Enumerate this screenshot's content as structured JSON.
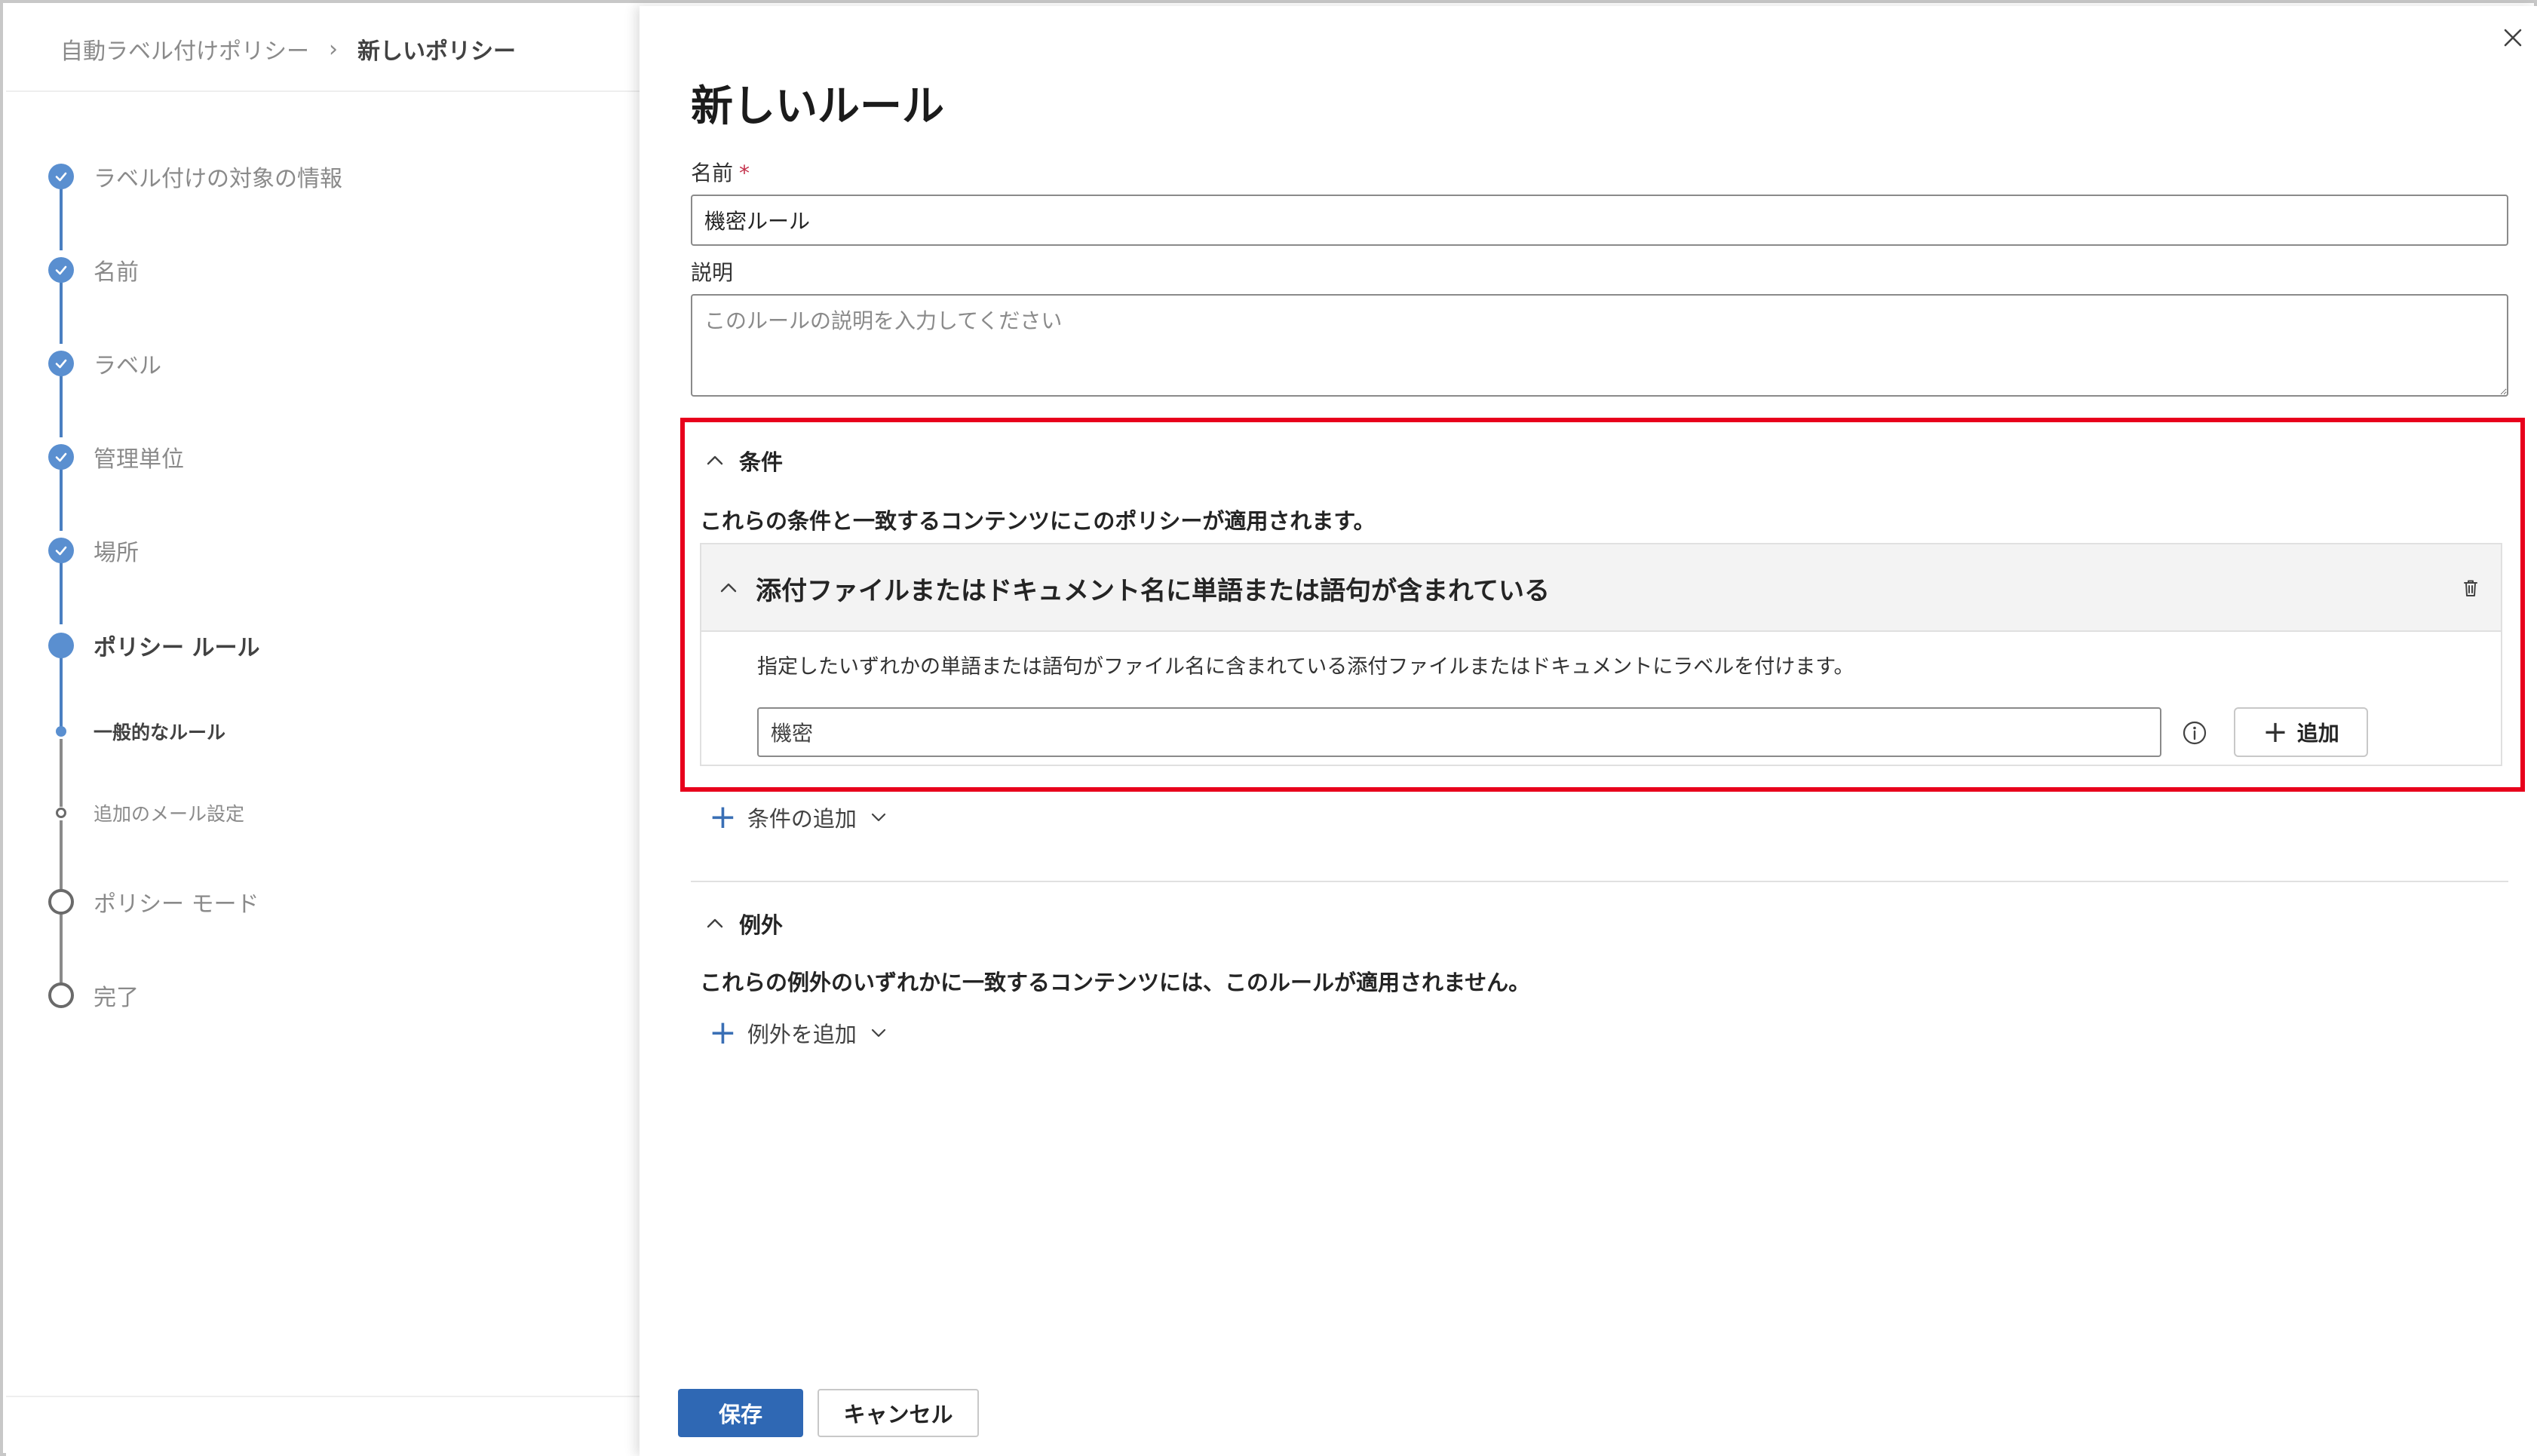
{
  "breadcrumb": {
    "parent": "自動ラベル付けポリシー",
    "separator": "›",
    "current": "新しいポリシー"
  },
  "wizard": {
    "steps": [
      {
        "label": "ラベル付けの対象の情報",
        "status": "completed"
      },
      {
        "label": "名前",
        "status": "completed"
      },
      {
        "label": "ラベル",
        "status": "completed"
      },
      {
        "label": "管理単位",
        "status": "completed"
      },
      {
        "label": "場所",
        "status": "completed"
      },
      {
        "label": "ポリシー ルール",
        "status": "current"
      },
      {
        "label": "一般的なルール",
        "status": "current-substep"
      },
      {
        "label": "追加のメール設定",
        "status": "pending-substep"
      },
      {
        "label": "ポリシー モード",
        "status": "pending"
      },
      {
        "label": "完了",
        "status": "pending"
      }
    ]
  },
  "flyout": {
    "title": "新しいルール",
    "name_label": "名前",
    "required_mark": "*",
    "name_value": "機密ルール",
    "description_label": "説明",
    "description_placeholder": "このルールの説明を入力してください",
    "conditions": {
      "header": "条件",
      "description": "これらの条件と一致するコンテンツにこのポリシーが適用されます。",
      "card": {
        "title": "添付ファイルまたはドキュメント名に単語または語句が含まれている",
        "description": "指定したいずれかの単語または語句がファイル名に含まれている添付ファイルまたはドキュメントにラベルを付けます。",
        "keyword_value": "機密",
        "add_button": "追加"
      },
      "add_condition": "条件の追加"
    },
    "exceptions": {
      "header": "例外",
      "description": "これらの例外のいずれかに一致するコンテンツには、このルールが適用されません。",
      "add_exception": "例外を追加"
    },
    "save_button": "保存",
    "cancel_button": "キャンセル"
  },
  "colors": {
    "accent": "#2f68b4",
    "step_blue": "#5a8fd0",
    "highlight_red": "#e8001c"
  },
  "icons": {
    "close": "close-icon",
    "chevron_up": "chevron-up-icon",
    "chevron_down": "chevron-down-icon",
    "trash": "trash-icon",
    "info": "info-icon",
    "plus": "plus-icon",
    "checkmark": "checkmark-icon"
  }
}
